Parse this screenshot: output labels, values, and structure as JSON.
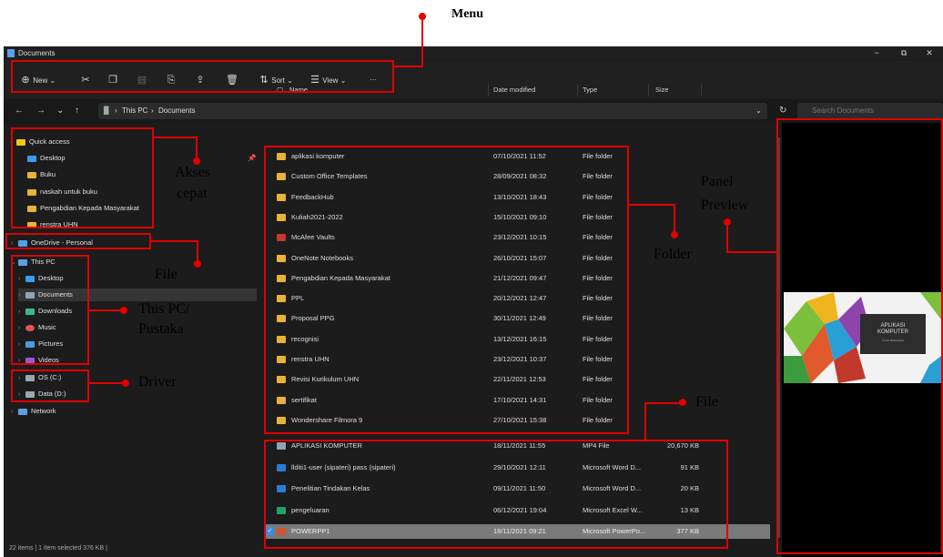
{
  "annotations": {
    "menu": "Menu",
    "akses": "Akses",
    "cepat": "cepat",
    "file_left": "File",
    "this_pc": "This PC/",
    "pustaka": "Pustaka",
    "driver": "Driver",
    "folder": "Folder",
    "file_right": "File",
    "panel": "Panel",
    "preview": "Preview"
  },
  "window": {
    "title": "Documents",
    "minimize": "−",
    "maximize": "⧉",
    "close": "✕"
  },
  "toolbar": {
    "new_label": "New",
    "sort_label": "Sort",
    "view_label": "View",
    "more_label": "···"
  },
  "address": {
    "this_pc": "This PC",
    "sep": "›",
    "documents": "Documents",
    "search_placeholder": "Search Documents"
  },
  "nav": {
    "quick_access": "Quick access",
    "quick_items": [
      "Desktop",
      "Buku",
      "naskah untuk buku",
      "Pengabdian Kepada Masyarakat",
      "renstra UHN"
    ],
    "onedrive": "OneDrive - Personal",
    "this_pc": "This PC",
    "pc_items": [
      "Desktop",
      "Documents",
      "Downloads",
      "Music",
      "Pictures",
      "Videos"
    ],
    "drives": [
      "OS (C:)",
      "Data (D:)"
    ],
    "network": "Network"
  },
  "columns": {
    "name": "Name",
    "date": "Date modified",
    "type": "Type",
    "size": "Size"
  },
  "files": [
    {
      "name": "aplikasi komputer",
      "date": "07/10/2021 11:52",
      "type": "File folder",
      "size": "",
      "kind": "folder"
    },
    {
      "name": "Custom Office Templates",
      "date": "28/09/2021 08:32",
      "type": "File folder",
      "size": "",
      "kind": "folder"
    },
    {
      "name": "FeedbackHub",
      "date": "13/10/2021 18:43",
      "type": "File folder",
      "size": "",
      "kind": "folder"
    },
    {
      "name": "Kuliah2021-2022",
      "date": "15/10/2021 09:10",
      "type": "File folder",
      "size": "",
      "kind": "folder"
    },
    {
      "name": "McAfee Vaults",
      "date": "23/12/2021 10:15",
      "type": "File folder",
      "size": "",
      "kind": "mcafee"
    },
    {
      "name": "OneNote Notebooks",
      "date": "26/10/2021 15:07",
      "type": "File folder",
      "size": "",
      "kind": "folder"
    },
    {
      "name": "Pengabdian Kepada Masyarakat",
      "date": "21/12/2021 09:47",
      "type": "File folder",
      "size": "",
      "kind": "folder"
    },
    {
      "name": "PPL",
      "date": "20/12/2021 12:47",
      "type": "File folder",
      "size": "",
      "kind": "folder"
    },
    {
      "name": "Proposal PPG",
      "date": "30/11/2021 12:49",
      "type": "File folder",
      "size": "",
      "kind": "folder"
    },
    {
      "name": "recognisi",
      "date": "13/12/2021 16:15",
      "type": "File folder",
      "size": "",
      "kind": "folder"
    },
    {
      "name": "renstra UHN",
      "date": "23/12/2021 10:37",
      "type": "File folder",
      "size": "",
      "kind": "folder"
    },
    {
      "name": "Revisi Kurikulum UHN",
      "date": "22/11/2021 12:53",
      "type": "File folder",
      "size": "",
      "kind": "folder"
    },
    {
      "name": "sertifikat",
      "date": "17/10/2021 14:31",
      "type": "File folder",
      "size": "",
      "kind": "folder"
    },
    {
      "name": "Wondershare Filmora 9",
      "date": "27/10/2021 15:38",
      "type": "File folder",
      "size": "",
      "kind": "folder"
    },
    {
      "name": "APLIKASI KOMPUTER",
      "date": "18/11/2021 11:55",
      "type": "MP4 File",
      "size": "20,670 KB",
      "kind": "mp4"
    },
    {
      "name": "llditi1-user (sipateri) pass (sipateri)",
      "date": "29/10/2021 12:11",
      "type": "Microsoft Word D...",
      "size": "91 KB",
      "kind": "word"
    },
    {
      "name": "Penelitian Tindakan Kelas",
      "date": "09/11/2021 11:50",
      "type": "Microsoft Word D...",
      "size": "20 KB",
      "kind": "word"
    },
    {
      "name": "pengeluaran",
      "date": "06/12/2021 19:04",
      "type": "Microsoft Excel W...",
      "size": "13 KB",
      "kind": "excel"
    },
    {
      "name": "POWERPP1",
      "date": "18/11/2021 09:21",
      "type": "Microsoft PowerPo...",
      "size": "377 KB",
      "kind": "ppt",
      "selected": true
    }
  ],
  "preview": {
    "slide_title_1": "APLIKASI",
    "slide_title_2": "KOMPUTER",
    "slide_sub": "Untuk Mahasiswa"
  },
  "status": "22 items  |  1 item selected  376 KB  |"
}
